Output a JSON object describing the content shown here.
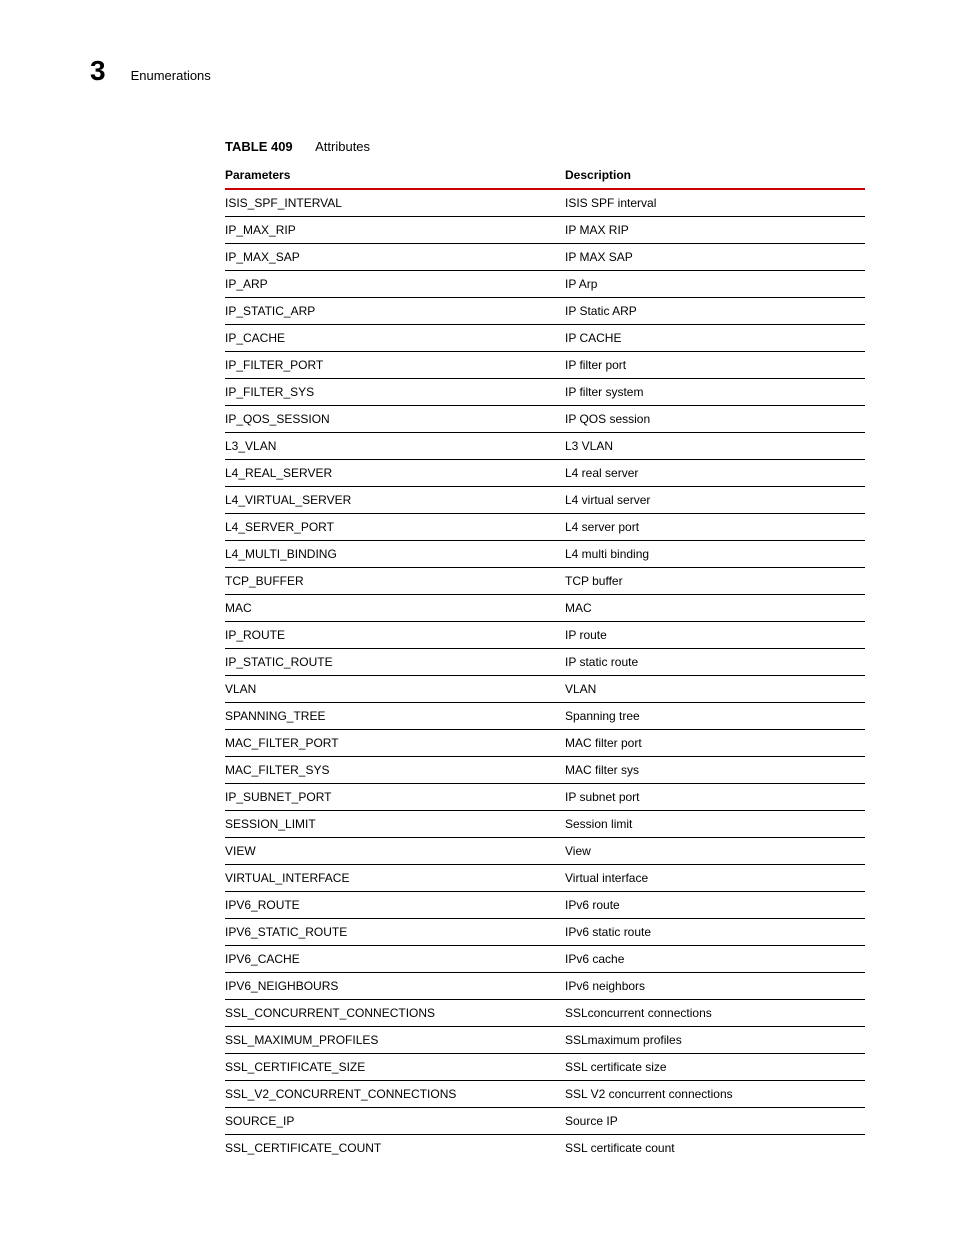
{
  "header": {
    "chapter_number": "3",
    "section_title": "Enumerations"
  },
  "table": {
    "number": "TABLE 409",
    "caption": "Attributes",
    "columns": {
      "param": "Parameters",
      "desc": "Description"
    },
    "rows": [
      {
        "param": "ISIS_SPF_INTERVAL",
        "desc": "ISIS SPF interval"
      },
      {
        "param": "IP_MAX_RIP",
        "desc": "IP MAX RIP"
      },
      {
        "param": "IP_MAX_SAP",
        "desc": "IP MAX SAP"
      },
      {
        "param": "IP_ARP",
        "desc": "IP Arp"
      },
      {
        "param": "IP_STATIC_ARP",
        "desc": "IP Static ARP"
      },
      {
        "param": "IP_CACHE",
        "desc": "IP CACHE"
      },
      {
        "param": "IP_FILTER_PORT",
        "desc": "IP filter port"
      },
      {
        "param": "IP_FILTER_SYS",
        "desc": "IP filter system"
      },
      {
        "param": "IP_QOS_SESSION",
        "desc": "IP QOS session"
      },
      {
        "param": "L3_VLAN",
        "desc": "L3 VLAN"
      },
      {
        "param": "L4_REAL_SERVER",
        "desc": "L4 real server"
      },
      {
        "param": "L4_VIRTUAL_SERVER",
        "desc": "L4 virtual server"
      },
      {
        "param": "L4_SERVER_PORT",
        "desc": "L4 server port"
      },
      {
        "param": "L4_MULTI_BINDING",
        "desc": "L4 multi binding"
      },
      {
        "param": "TCP_BUFFER",
        "desc": "TCP buffer"
      },
      {
        "param": "MAC",
        "desc": "MAC"
      },
      {
        "param": "IP_ROUTE",
        "desc": "IP route"
      },
      {
        "param": "IP_STATIC_ROUTE",
        "desc": "IP static route"
      },
      {
        "param": "VLAN",
        "desc": "VLAN"
      },
      {
        "param": "SPANNING_TREE",
        "desc": "Spanning tree"
      },
      {
        "param": "MAC_FILTER_PORT",
        "desc": "MAC filter port"
      },
      {
        "param": "MAC_FILTER_SYS",
        "desc": "MAC filter sys"
      },
      {
        "param": "IP_SUBNET_PORT",
        "desc": "IP subnet port"
      },
      {
        "param": "SESSION_LIMIT",
        "desc": "Session limit"
      },
      {
        "param": "VIEW",
        "desc": "View"
      },
      {
        "param": "VIRTUAL_INTERFACE",
        "desc": "Virtual interface"
      },
      {
        "param": "IPV6_ROUTE",
        "desc": "IPv6 route"
      },
      {
        "param": "IPV6_STATIC_ROUTE",
        "desc": "IPv6 static route"
      },
      {
        "param": "IPV6_CACHE",
        "desc": "IPv6 cache"
      },
      {
        "param": "IPV6_NEIGHBOURS",
        "desc": "IPv6 neighbors"
      },
      {
        "param": "SSL_CONCURRENT_CONNECTIONS",
        "desc": "SSLconcurrent connections"
      },
      {
        "param": "SSL_MAXIMUM_PROFILES",
        "desc": "SSLmaximum profiles"
      },
      {
        "param": "SSL_CERTIFICATE_SIZE",
        "desc": "SSL certificate size"
      },
      {
        "param": "SSL_V2_CONCURRENT_CONNECTIONS",
        "desc": "SSL V2 concurrent connections"
      },
      {
        "param": "SOURCE_IP",
        "desc": "Source IP"
      },
      {
        "param": "SSL_CERTIFICATE_COUNT",
        "desc": "SSL certificate count"
      }
    ]
  }
}
